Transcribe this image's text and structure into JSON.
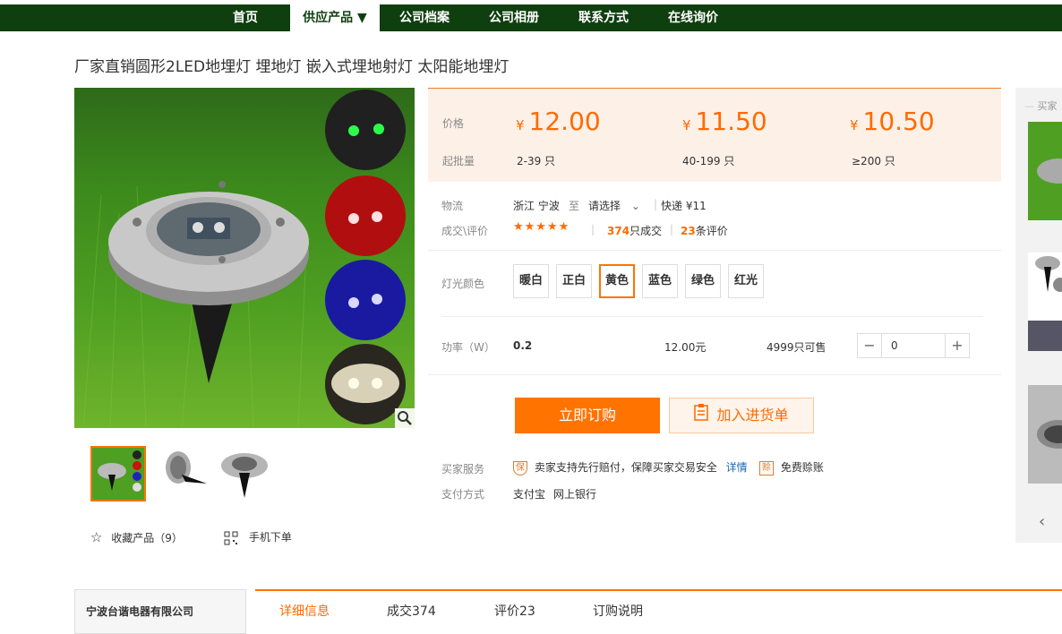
{
  "nav": {
    "items": [
      "首页",
      "供应产品 ▼",
      "公司档案",
      "公司相册",
      "联系方式",
      "在线询价"
    ]
  },
  "product": {
    "title": "厂家直销圆形2LED地埋灯 埋地灯 嵌入式埋地射灯 太阳能地埋灯"
  },
  "gallery": {
    "favorite_label": "收藏产品（9）",
    "mobile_label": "手机下单"
  },
  "pricing": {
    "price_label": "价格",
    "moq_label": "起批量",
    "currency": "¥",
    "tiers": [
      {
        "price": "12.00",
        "range": "2-39 只"
      },
      {
        "price": "11.50",
        "range": "40-199 只"
      },
      {
        "price": "10.50",
        "range": "≥200 只"
      }
    ]
  },
  "logistics": {
    "label": "物流",
    "origin": "浙江 宁波",
    "to": "至",
    "destination": "请选择",
    "shipping": "快递 ¥11"
  },
  "reviews": {
    "label": "成交\\评价",
    "stars": "★★★★★",
    "deals_count": "374",
    "deals_suffix": "只成交",
    "review_count": "23",
    "review_suffix": "条评价"
  },
  "options": {
    "label": "灯光颜色",
    "colors": [
      "暖白",
      "正白",
      "黄色",
      "蓝色",
      "绿色",
      "红光"
    ],
    "selected": "黄色"
  },
  "sku": {
    "label": "功率（W）",
    "value": "0.2",
    "price": "12.00元",
    "stock": "4999只可售",
    "quantity": "0"
  },
  "actions": {
    "order": "立即订购",
    "cart": "加入进货单"
  },
  "service": {
    "label": "买家服务",
    "guarantee": "卖家支持先行赔付，保障买家交易安全",
    "detail": "详情",
    "compensation": "免费赊账"
  },
  "payment": {
    "label": "支付方式",
    "methods": [
      "支付宝",
      "网上银行"
    ]
  },
  "sidebar": {
    "title": "买家"
  },
  "company": {
    "name": "宁波台谐电器有限公司"
  },
  "tabs": [
    "详细信息",
    "成交374",
    "评价23",
    "订购说明"
  ],
  "colors": {
    "nav_bg": "#0f3f0f",
    "accent": "#ff7300",
    "price": "#ff6a00"
  }
}
